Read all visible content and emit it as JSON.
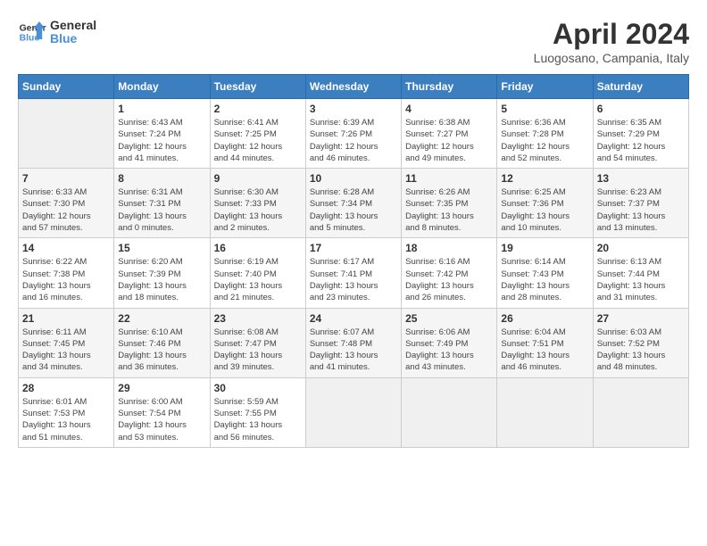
{
  "logo": {
    "line1": "General",
    "line2": "Blue"
  },
  "title": "April 2024",
  "subtitle": "Luogosano, Campania, Italy",
  "days_of_week": [
    "Sunday",
    "Monday",
    "Tuesday",
    "Wednesday",
    "Thursday",
    "Friday",
    "Saturday"
  ],
  "weeks": [
    [
      {
        "day": "",
        "info": ""
      },
      {
        "day": "1",
        "info": "Sunrise: 6:43 AM\nSunset: 7:24 PM\nDaylight: 12 hours\nand 41 minutes."
      },
      {
        "day": "2",
        "info": "Sunrise: 6:41 AM\nSunset: 7:25 PM\nDaylight: 12 hours\nand 44 minutes."
      },
      {
        "day": "3",
        "info": "Sunrise: 6:39 AM\nSunset: 7:26 PM\nDaylight: 12 hours\nand 46 minutes."
      },
      {
        "day": "4",
        "info": "Sunrise: 6:38 AM\nSunset: 7:27 PM\nDaylight: 12 hours\nand 49 minutes."
      },
      {
        "day": "5",
        "info": "Sunrise: 6:36 AM\nSunset: 7:28 PM\nDaylight: 12 hours\nand 52 minutes."
      },
      {
        "day": "6",
        "info": "Sunrise: 6:35 AM\nSunset: 7:29 PM\nDaylight: 12 hours\nand 54 minutes."
      }
    ],
    [
      {
        "day": "7",
        "info": "Sunrise: 6:33 AM\nSunset: 7:30 PM\nDaylight: 12 hours\nand 57 minutes."
      },
      {
        "day": "8",
        "info": "Sunrise: 6:31 AM\nSunset: 7:31 PM\nDaylight: 13 hours\nand 0 minutes."
      },
      {
        "day": "9",
        "info": "Sunrise: 6:30 AM\nSunset: 7:33 PM\nDaylight: 13 hours\nand 2 minutes."
      },
      {
        "day": "10",
        "info": "Sunrise: 6:28 AM\nSunset: 7:34 PM\nDaylight: 13 hours\nand 5 minutes."
      },
      {
        "day": "11",
        "info": "Sunrise: 6:26 AM\nSunset: 7:35 PM\nDaylight: 13 hours\nand 8 minutes."
      },
      {
        "day": "12",
        "info": "Sunrise: 6:25 AM\nSunset: 7:36 PM\nDaylight: 13 hours\nand 10 minutes."
      },
      {
        "day": "13",
        "info": "Sunrise: 6:23 AM\nSunset: 7:37 PM\nDaylight: 13 hours\nand 13 minutes."
      }
    ],
    [
      {
        "day": "14",
        "info": "Sunrise: 6:22 AM\nSunset: 7:38 PM\nDaylight: 13 hours\nand 16 minutes."
      },
      {
        "day": "15",
        "info": "Sunrise: 6:20 AM\nSunset: 7:39 PM\nDaylight: 13 hours\nand 18 minutes."
      },
      {
        "day": "16",
        "info": "Sunrise: 6:19 AM\nSunset: 7:40 PM\nDaylight: 13 hours\nand 21 minutes."
      },
      {
        "day": "17",
        "info": "Sunrise: 6:17 AM\nSunset: 7:41 PM\nDaylight: 13 hours\nand 23 minutes."
      },
      {
        "day": "18",
        "info": "Sunrise: 6:16 AM\nSunset: 7:42 PM\nDaylight: 13 hours\nand 26 minutes."
      },
      {
        "day": "19",
        "info": "Sunrise: 6:14 AM\nSunset: 7:43 PM\nDaylight: 13 hours\nand 28 minutes."
      },
      {
        "day": "20",
        "info": "Sunrise: 6:13 AM\nSunset: 7:44 PM\nDaylight: 13 hours\nand 31 minutes."
      }
    ],
    [
      {
        "day": "21",
        "info": "Sunrise: 6:11 AM\nSunset: 7:45 PM\nDaylight: 13 hours\nand 34 minutes."
      },
      {
        "day": "22",
        "info": "Sunrise: 6:10 AM\nSunset: 7:46 PM\nDaylight: 13 hours\nand 36 minutes."
      },
      {
        "day": "23",
        "info": "Sunrise: 6:08 AM\nSunset: 7:47 PM\nDaylight: 13 hours\nand 39 minutes."
      },
      {
        "day": "24",
        "info": "Sunrise: 6:07 AM\nSunset: 7:48 PM\nDaylight: 13 hours\nand 41 minutes."
      },
      {
        "day": "25",
        "info": "Sunrise: 6:06 AM\nSunset: 7:49 PM\nDaylight: 13 hours\nand 43 minutes."
      },
      {
        "day": "26",
        "info": "Sunrise: 6:04 AM\nSunset: 7:51 PM\nDaylight: 13 hours\nand 46 minutes."
      },
      {
        "day": "27",
        "info": "Sunrise: 6:03 AM\nSunset: 7:52 PM\nDaylight: 13 hours\nand 48 minutes."
      }
    ],
    [
      {
        "day": "28",
        "info": "Sunrise: 6:01 AM\nSunset: 7:53 PM\nDaylight: 13 hours\nand 51 minutes."
      },
      {
        "day": "29",
        "info": "Sunrise: 6:00 AM\nSunset: 7:54 PM\nDaylight: 13 hours\nand 53 minutes."
      },
      {
        "day": "30",
        "info": "Sunrise: 5:59 AM\nSunset: 7:55 PM\nDaylight: 13 hours\nand 56 minutes."
      },
      {
        "day": "",
        "info": ""
      },
      {
        "day": "",
        "info": ""
      },
      {
        "day": "",
        "info": ""
      },
      {
        "day": "",
        "info": ""
      }
    ]
  ]
}
